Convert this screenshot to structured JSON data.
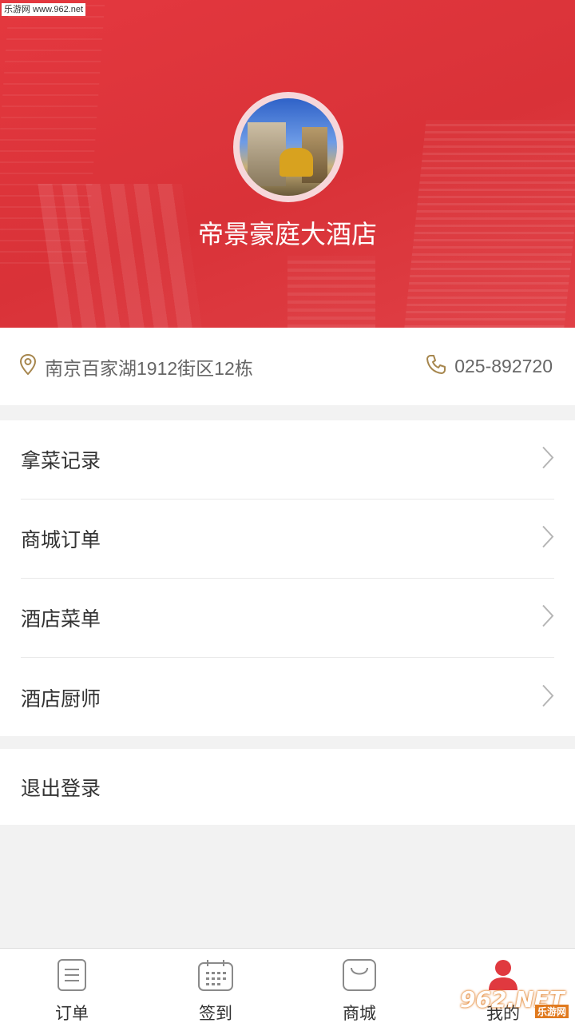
{
  "watermark_top": "乐游网 www.962.net",
  "hotel": {
    "name": "帝景豪庭大酒店",
    "address": "南京百家湖1912街区12栋",
    "phone": "025-892720"
  },
  "menu": {
    "items": [
      {
        "label": "拿菜记录"
      },
      {
        "label": "商城订单"
      },
      {
        "label": "酒店菜单"
      },
      {
        "label": "酒店厨师"
      }
    ]
  },
  "logout_label": "退出登录",
  "tabbar": {
    "tabs": [
      {
        "label": "订单",
        "icon": "order-icon"
      },
      {
        "label": "签到",
        "icon": "calendar-icon"
      },
      {
        "label": "商城",
        "icon": "shop-bag-icon"
      },
      {
        "label": "我的",
        "icon": "user-icon"
      }
    ]
  },
  "watermark_br": {
    "logo": "962.NET",
    "sub": "乐游网"
  },
  "colors": {
    "header_red": "#e0393f",
    "icon_brown": "#a6864d",
    "active_red": "#e0393f"
  }
}
